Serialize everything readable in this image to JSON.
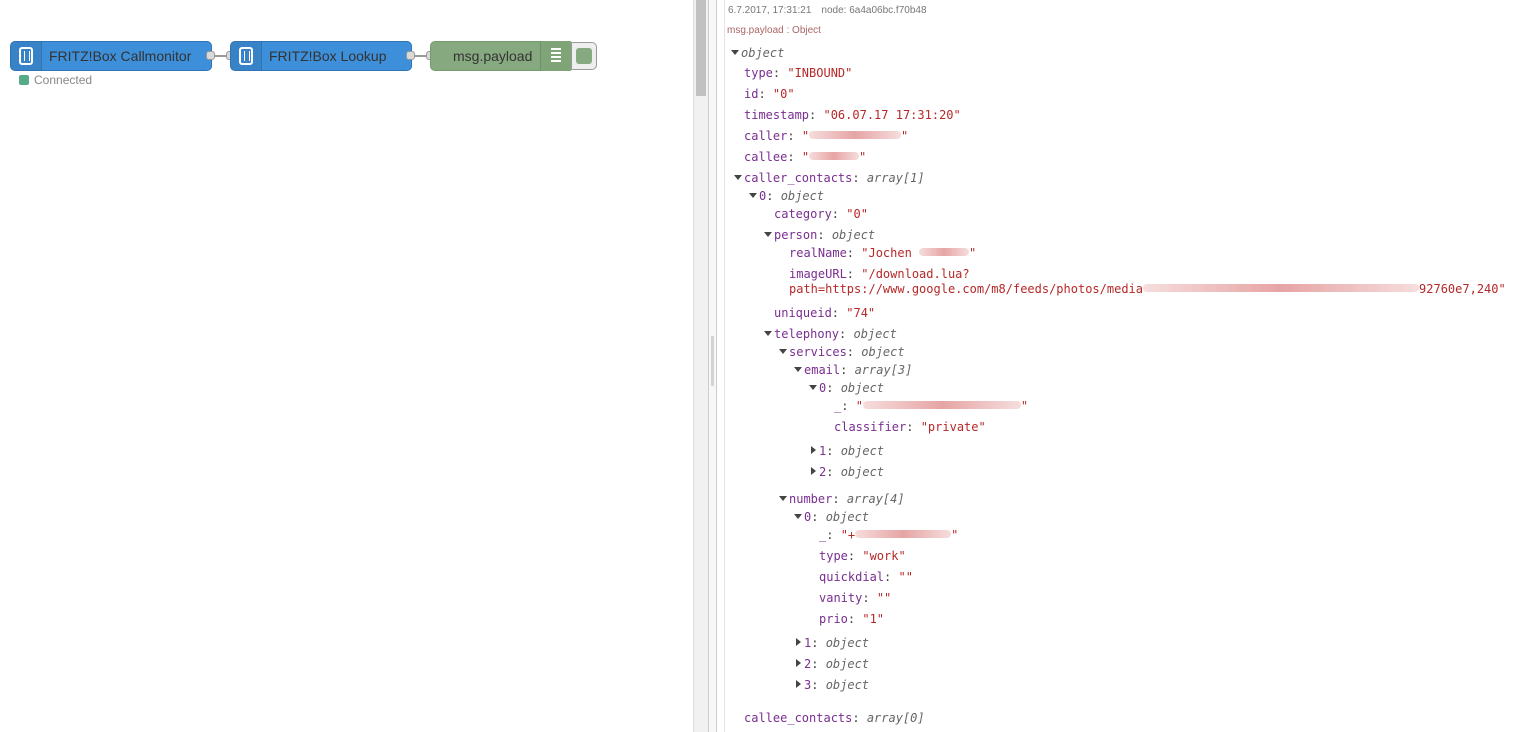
{
  "flow": {
    "nodes": [
      {
        "label": "FRITZ!Box Callmonitor",
        "status": "Connected"
      },
      {
        "label": "FRITZ!Box Lookup"
      },
      {
        "label": "msg.payload"
      }
    ]
  },
  "debug": {
    "timestamp": "6.7.2017, 17:31:21",
    "node": "node: 6a4a06bc.f70b48",
    "topic": "msg.payload : Object",
    "root_type": "object",
    "fields": {
      "type": {
        "key": "type",
        "value": "\"INBOUND\""
      },
      "id": {
        "key": "id",
        "value": "\"0\""
      },
      "timestamp": {
        "key": "timestamp",
        "value": "\"06.07.17 17:31:20\""
      },
      "caller": {
        "key": "caller",
        "value_open": "\"",
        "value_close": "\""
      },
      "callee": {
        "key": "callee",
        "value_open": "\"",
        "value_close": "\""
      },
      "caller_contacts": {
        "key": "caller_contacts",
        "type": "array[1]"
      },
      "cc0": {
        "key": "0",
        "type": "object"
      },
      "category": {
        "key": "category",
        "value": "\"0\""
      },
      "person": {
        "key": "person",
        "type": "object"
      },
      "realName": {
        "key": "realName",
        "value_open": "\"Jochen ",
        "value_close": "\""
      },
      "imageURL": {
        "key": "imageURL",
        "line1": "\"/download.lua?",
        "line2_start": "path=https://www.google.com/m8/feeds/photos/media",
        "line2_end": "92760e7,240\""
      },
      "uniqueid": {
        "key": "uniqueid",
        "value": "\"74\""
      },
      "telephony": {
        "key": "telephony",
        "type": "object"
      },
      "services": {
        "key": "services",
        "type": "object"
      },
      "email": {
        "key": "email",
        "type": "array[3]"
      },
      "email0": {
        "key": "0",
        "type": "object"
      },
      "email0_": {
        "key": "_",
        "value_open": "\"",
        "value_close": "\""
      },
      "classifier": {
        "key": "classifier",
        "value": "\"private\""
      },
      "email1": {
        "key": "1",
        "type": "object"
      },
      "email2": {
        "key": "2",
        "type": "object"
      },
      "number": {
        "key": "number",
        "type": "array[4]"
      },
      "number0": {
        "key": "0",
        "type": "object"
      },
      "number0_": {
        "key": "_",
        "value_open": "\"+",
        "value_close": "\""
      },
      "ntype": {
        "key": "type",
        "value": "\"work\""
      },
      "quickdial": {
        "key": "quickdial",
        "value": "\"\""
      },
      "vanity": {
        "key": "vanity",
        "value": "\"\""
      },
      "prio": {
        "key": "prio",
        "value": "\"1\""
      },
      "number1": {
        "key": "1",
        "type": "object"
      },
      "number2": {
        "key": "2",
        "type": "object"
      },
      "number3": {
        "key": "3",
        "type": "object"
      },
      "callee_contacts": {
        "key": "callee_contacts",
        "type": "array[0]"
      }
    }
  }
}
